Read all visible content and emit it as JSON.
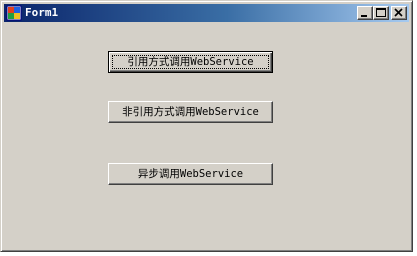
{
  "window": {
    "title": "Form1",
    "title_bar_color": "#0a246a",
    "title_bar_gradient_end": "#a6caf0",
    "client_background": "#d4d0c8"
  },
  "caption_buttons": {
    "minimize_icon": "minimize-icon",
    "maximize_icon": "maximize-icon",
    "close_icon": "close-icon"
  },
  "buttons": [
    {
      "label": "引用方式调用WebService",
      "focused": true
    },
    {
      "label": "非引用方式调用WebService",
      "focused": false
    },
    {
      "label": "异步调用WebService",
      "focused": false
    }
  ]
}
